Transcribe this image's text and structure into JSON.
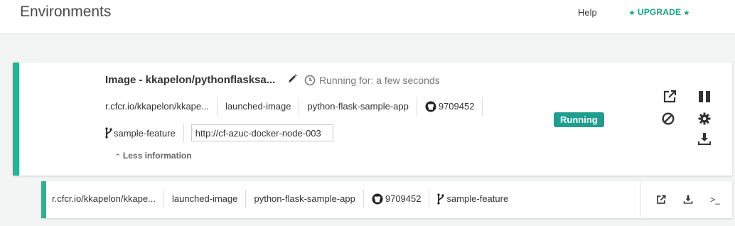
{
  "header": {
    "title": "Environments",
    "help_label": "Help",
    "upgrade_label": "UPGRADE",
    "upgrade_star": "★"
  },
  "colors": {
    "accent": "#20b791",
    "badge": "#1f9e8f",
    "upgrade": "#1fa187"
  },
  "environment": {
    "image_name": "Image - kkapelon/pythonflasksa...",
    "running_for": "Running for: a few seconds",
    "tags": [
      "r.cfcr.io/kkapelon/kkape...",
      "launched-image",
      "python-flask-sample-app"
    ],
    "commit": "9709452",
    "branch": "sample-feature",
    "url_value": "http://cf-azuc-docker-node-003",
    "less_info": "Less information",
    "status": "Running",
    "icons": [
      "pencil-icon",
      "clock-icon",
      "github-icon",
      "branch-icon",
      "external-link-icon",
      "pause-icon",
      "stop-icon",
      "settings-icon",
      "download-icon"
    ]
  },
  "row": {
    "tags": [
      "r.cfcr.io/kkapelon/kkape...",
      "launched-image",
      "python-flask-sample-app"
    ],
    "commit": "9709452",
    "branch": "sample-feature",
    "terminal_label": ">_"
  }
}
